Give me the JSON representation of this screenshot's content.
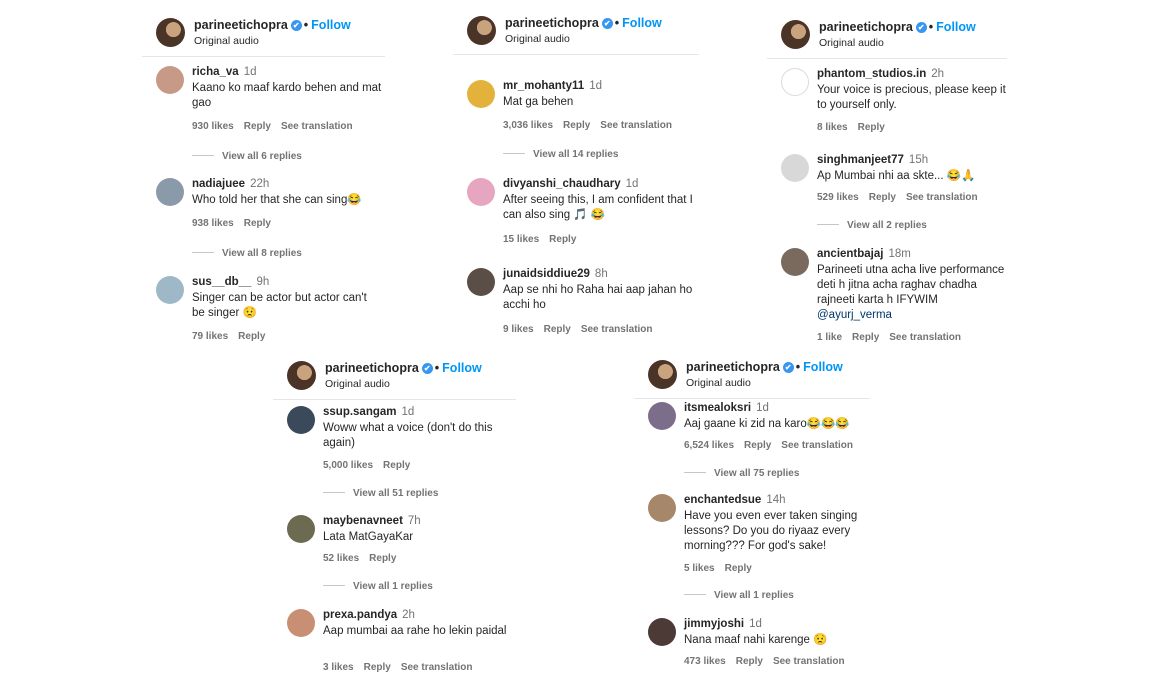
{
  "header": {
    "username": "parineetichopra",
    "follow": "Follow",
    "subtitle": "Original audio",
    "verified": "✔",
    "dot": "•"
  },
  "actions": {
    "reply": "Reply",
    "see_translation": "See translation"
  },
  "panels": [
    {
      "comments": [
        {
          "user": "richa_va",
          "time": "1d",
          "text": "Kaano ko maaf kardo behen and mat gao",
          "likes": "930 likes",
          "translation": true,
          "replies": "View all 6 replies"
        },
        {
          "user": "nadiajuee",
          "time": "22h",
          "text": "Who told her that she can sing😂",
          "likes": "938 likes",
          "translation": false,
          "replies": "View all 8 replies"
        },
        {
          "user": "sus__db__",
          "time": "9h",
          "text": "Singer can be actor but actor can't be singer 😟",
          "likes": "79 likes",
          "translation": false,
          "replies": ""
        }
      ]
    },
    {
      "comments": [
        {
          "user": "mr_mohanty11",
          "time": "1d",
          "text": "Mat ga behen",
          "likes": "3,036 likes",
          "translation": true,
          "replies": "View all 14 replies"
        },
        {
          "user": "divyanshi_chaudhary",
          "time": "1d",
          "text": "After seeing this, I am confident that I can also sing 🎵 😂",
          "likes": "15 likes",
          "translation": false,
          "replies": ""
        },
        {
          "user": "junaidsiddiue29",
          "time": "8h",
          "text": "Aap se nhi ho Raha hai aap jahan ho acchi ho",
          "likes": "9 likes",
          "translation": true,
          "replies": ""
        }
      ]
    },
    {
      "comments": [
        {
          "user": "phantom_studios.in",
          "time": "2h",
          "text": "Your voice is precious, please keep it to yourself only.",
          "likes": "8 likes",
          "translation": false,
          "replies": ""
        },
        {
          "user": "singhmanjeet77",
          "time": "15h",
          "text": "Ap Mumbai nhi aa skte... 😂🙏",
          "likes": "529 likes",
          "translation": true,
          "replies": "View all 2 replies"
        },
        {
          "user": "ancientbajaj",
          "time": "18m",
          "text": "Parineeti utna acha live performance deti h jitna acha raghav chadha rajneeti karta h IFYWIM",
          "mention": "@ayurj_verma",
          "likes": "1 like",
          "translation": true,
          "replies": ""
        }
      ]
    },
    {
      "comments": [
        {
          "user": "ssup.sangam",
          "time": "1d",
          "text": "Woww what a voice (don't do this again)",
          "likes": "5,000 likes",
          "translation": false,
          "replies": "View all 51 replies"
        },
        {
          "user": "maybenavneet",
          "time": "7h",
          "text": "Lata MatGayaKar",
          "likes": "52 likes",
          "translation": false,
          "replies": "View all 1 replies"
        },
        {
          "user": "prexa.pandya",
          "time": "2h",
          "text": "Aap mumbai aa rahe ho lekin paidal",
          "likes": "3 likes",
          "translation": true,
          "replies": ""
        }
      ]
    },
    {
      "comments": [
        {
          "user": "itsmealoksri",
          "time": "1d",
          "text": "Aaj gaane ki zid na karo😂😂😂",
          "likes": "6,524 likes",
          "translation": true,
          "replies": "View all 75 replies"
        },
        {
          "user": "enchantedsue",
          "time": "14h",
          "text": "Have you even ever taken singing lessons? Do you do riyaaz every morning??? For god's sake!",
          "likes": "5 likes",
          "translation": false,
          "replies": "View all 1 replies"
        },
        {
          "user": "jimmyjoshi",
          "time": "1d",
          "text": "Nana maaf nahi karenge 😟",
          "likes": "473 likes",
          "translation": true,
          "replies": ""
        }
      ]
    }
  ]
}
